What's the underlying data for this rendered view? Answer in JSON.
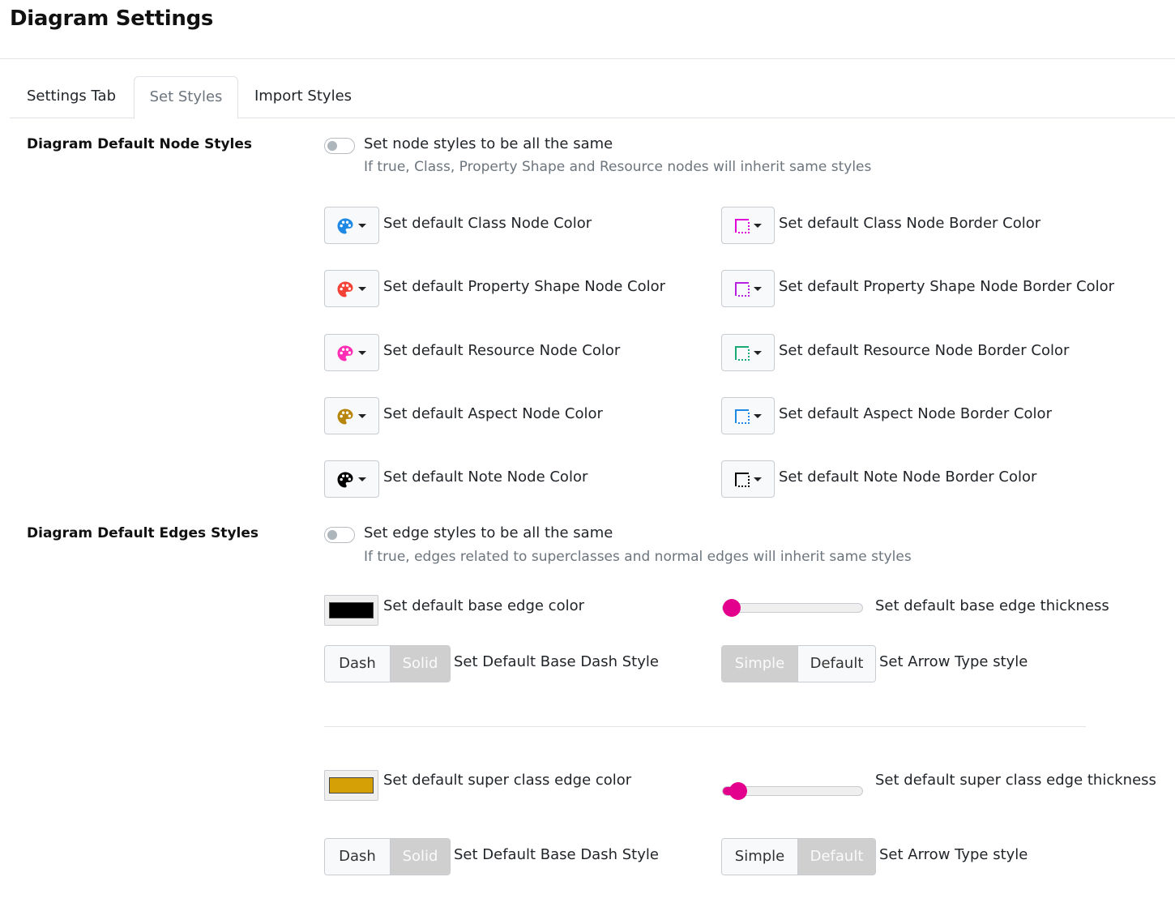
{
  "page": {
    "title": "Diagram Settings"
  },
  "tabs": [
    {
      "label": "Settings Tab",
      "active": false
    },
    {
      "label": "Set Styles",
      "active": true
    },
    {
      "label": "Import Styles",
      "active": false
    }
  ],
  "node_styles": {
    "section_title": "Diagram Default Node Styles",
    "toggle": {
      "label": "Set node styles to be all the same",
      "hint": "If true, Class, Property Shape and Resource nodes will inherit same styles",
      "checked": false
    },
    "rows": [
      {
        "color_label": "Set default Class Node Color",
        "color": "#1e88e5",
        "color_icon": "palette-icon",
        "border_label": "Set default Class Node Border Color",
        "border_color": "#e000d8",
        "border_icon": "border-style-icon"
      },
      {
        "color_label": "Set default Property Shape Node Color",
        "color": "#f44336",
        "color_icon": "palette-icon",
        "border_label": "Set default Property Shape Node Border Color",
        "border_color": "#b620e0",
        "border_icon": "border-style-icon"
      },
      {
        "color_label": "Set default Resource Node Color",
        "color": "#ff2eb4",
        "color_icon": "palette-icon",
        "border_label": "Set default Resource Node Border Color",
        "border_color": "#19a974",
        "border_icon": "border-style-icon"
      },
      {
        "color_label": "Set default Aspect Node Color",
        "color": "#b8860b",
        "color_icon": "palette-icon",
        "border_label": "Set default Aspect Node Border Color",
        "border_color": "#1e88e5",
        "border_icon": "border-style-icon"
      },
      {
        "color_label": "Set default Note Node Color",
        "color": "#000000",
        "color_icon": "palette-icon",
        "border_label": "Set default Note Node Border Color",
        "border_color": "#000000",
        "border_icon": "border-style-icon"
      }
    ]
  },
  "edge_styles": {
    "section_title": "Diagram Default Edges Styles",
    "toggle": {
      "label": "Set edge styles to be all the same",
      "hint": "If true, edges related to superclasses and normal edges will inherit same styles",
      "checked": false
    },
    "base": {
      "color_label": "Set default base edge color",
      "color": "#000000",
      "thickness_label": "Set default base edge thickness",
      "thickness_fraction": 0.0,
      "dash_options": [
        "Dash",
        "Solid"
      ],
      "dash_selected": "Solid",
      "dash_label": "Set Default Base Dash Style",
      "arrow_options": [
        "Simple",
        "Default"
      ],
      "arrow_selected": "Simple",
      "arrow_label": "Set Arrow Type style"
    },
    "superclass": {
      "color_label": "Set default super class edge color",
      "color": "#d4a006",
      "thickness_label": "Set default super class edge thickness",
      "thickness_fraction": 0.05,
      "dash_options": [
        "Dash",
        "Solid"
      ],
      "dash_selected": "Solid",
      "dash_label": "Set Default Base Dash Style",
      "arrow_options": [
        "Simple",
        "Default"
      ],
      "arrow_selected": "Default",
      "arrow_label": "Set Arrow Type style"
    }
  },
  "accent": {
    "slider": "#e3008c",
    "selected_segment": "#cfcfcf"
  }
}
